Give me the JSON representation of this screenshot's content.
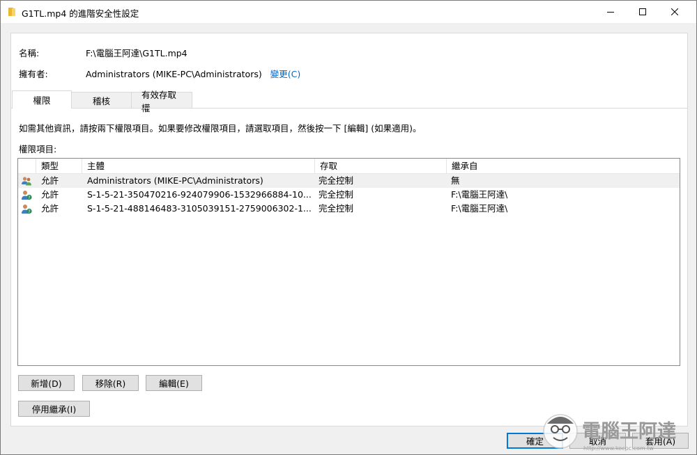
{
  "window": {
    "title": "G1TL.mp4 的進階安全性設定"
  },
  "fields": {
    "name_label": "名稱:",
    "name_value": "F:\\電腦王阿達\\G1TL.mp4",
    "owner_label": "擁有者:",
    "owner_value": "Administrators (MIKE-PC\\Administrators)",
    "change_link": "變更(C)"
  },
  "tabs": [
    {
      "label": "權限"
    },
    {
      "label": "稽核"
    },
    {
      "label": "有效存取權"
    }
  ],
  "info_text": "如需其他資訊，請按兩下權限項目。如果要修改權限項目，請選取項目，然後按一下 [編輯] (如果適用)。",
  "entries_label": "權限項目:",
  "table": {
    "columns": [
      "類型",
      "主體",
      "存取",
      "繼承自"
    ],
    "rows": [
      {
        "icon": "group-users-icon",
        "type": "允許",
        "principal": "Administrators (MIKE-PC\\Administrators)",
        "access": "完全控制",
        "inherited": "無"
      },
      {
        "icon": "unknown-user-icon",
        "type": "允許",
        "principal": "S-1-5-21-350470216-924079906-1532966884-10...",
        "access": "完全控制",
        "inherited": "F:\\電腦王阿達\\"
      },
      {
        "icon": "unknown-user-icon",
        "type": "允許",
        "principal": "S-1-5-21-488146483-3105039151-2759006302-1...",
        "access": "完全控制",
        "inherited": "F:\\電腦王阿達\\"
      }
    ]
  },
  "buttons": {
    "add": "新增(D)",
    "remove": "移除(R)",
    "edit": "編輯(E)",
    "disable_inheritance": "停用繼承(I)",
    "ok": "確定",
    "cancel": "取消",
    "apply": "套用(A)"
  },
  "watermark": {
    "brand": "電腦王阿達",
    "url": "http://www.kocpc.com.tw"
  },
  "colors": {
    "link": "#0066cc",
    "accent": "#0078d7"
  }
}
